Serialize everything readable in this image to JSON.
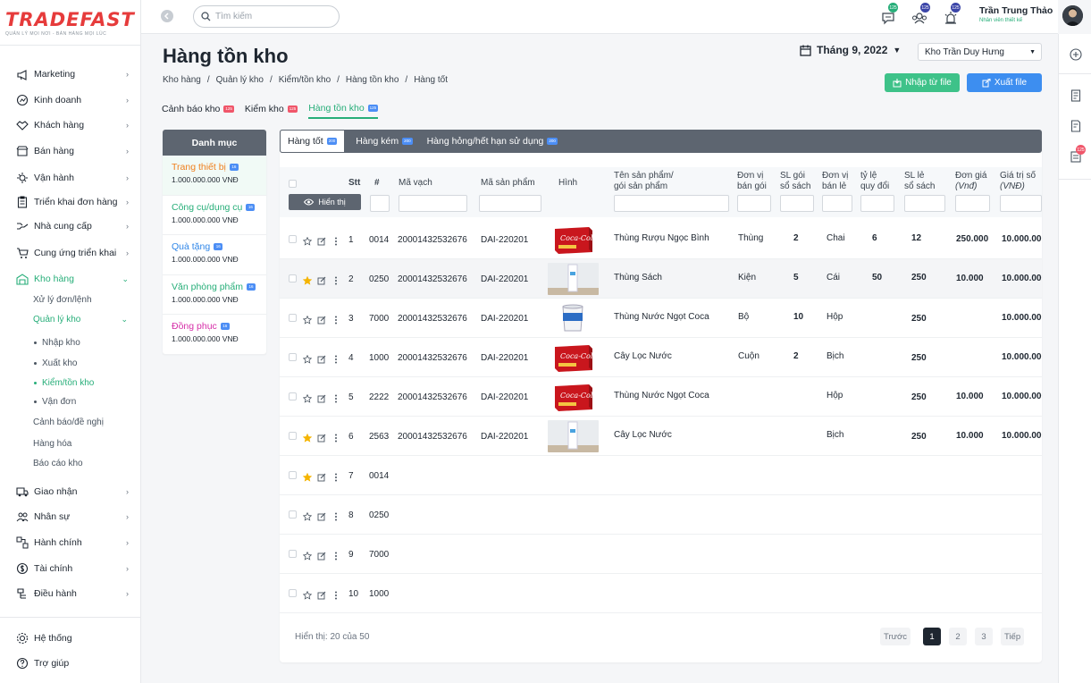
{
  "brand": {
    "logo_a": "TRADE",
    "logo_b": "FAST",
    "tagline": "QUẢN LÝ MỌI NƠI - BÁN HÀNG MỌI LÚC"
  },
  "sidebar": {
    "items": [
      {
        "label": "Marketing",
        "icon": "megaphone-icon"
      },
      {
        "label": "Kinh doanh",
        "icon": "business-icon"
      },
      {
        "label": "Khách hàng",
        "icon": "handshake-icon"
      },
      {
        "label": "Bán hàng",
        "icon": "shop-icon"
      },
      {
        "label": "Vận hành",
        "icon": "operations-icon"
      },
      {
        "label": "Triển khai đơn hàng",
        "icon": "clipboard-icon"
      },
      {
        "label": "Nhà cung cấp",
        "icon": "supplier-icon"
      },
      {
        "label": "Cung ứng triển khai",
        "icon": "cart-icon"
      },
      {
        "label": "Kho hàng",
        "icon": "warehouse-icon"
      }
    ],
    "warehouse_sub": [
      "Xử lý đơn/lệnh",
      "Quản lý kho"
    ],
    "inventory_sub": [
      "Nhập kho",
      "Xuất kho",
      "Kiểm/tồn kho",
      "Vận đơn"
    ],
    "warehouse_more": [
      "Cảnh báo/đề nghị",
      "Hàng hóa",
      "Báo cáo kho"
    ],
    "items2": [
      {
        "label": "Giao nhận",
        "icon": "delivery-icon"
      },
      {
        "label": "Nhân sự",
        "icon": "people-icon"
      },
      {
        "label": "Hành chính",
        "icon": "admin-icon"
      },
      {
        "label": "Tài chính",
        "icon": "finance-icon"
      },
      {
        "label": "Điều hành",
        "icon": "management-icon"
      }
    ],
    "bottom": [
      {
        "label": "Hệ thống",
        "icon": "gear-icon"
      },
      {
        "label": "Trợ giúp",
        "icon": "help-icon"
      }
    ]
  },
  "header": {
    "search_placeholder": "Tìm kiếm",
    "badges": [
      "125",
      "125",
      "125"
    ],
    "user_name": "Trần Trung Thảo",
    "user_role": "Nhân viên thiết kế",
    "rail_badge": "125"
  },
  "page": {
    "title": "Hàng tồn kho",
    "breadcrumb": [
      "Kho hàng",
      "Quản lý kho",
      "Kiểm/tồn kho",
      "Hàng tồn kho",
      "Hàng tốt"
    ],
    "month": "Tháng 9, 2022",
    "warehouse": "Kho Trần Duy Hưng",
    "import_label": "Nhập từ file",
    "export_label": "Xuất file"
  },
  "tabs": [
    {
      "label": "Cảnh báo kho",
      "badge": "125"
    },
    {
      "label": "Kiểm kho",
      "badge": "125"
    },
    {
      "label": "Hàng tồn kho",
      "badge": "125"
    }
  ],
  "categories": {
    "title": "Danh mục",
    "items": [
      {
        "name": "Trang thiết bị",
        "badge": "16",
        "value": "1.000.000.000 VNĐ",
        "color": "#f07f1d"
      },
      {
        "name": "Công cụ/dụng cụ",
        "badge": "16",
        "value": "1.000.000.000 VNĐ",
        "color": "#27ae79"
      },
      {
        "name": "Quà tặng",
        "badge": "16",
        "value": "1.000.000.000 VNĐ",
        "color": "#2f86e8"
      },
      {
        "name": "Văn phòng phẩm",
        "badge": "16",
        "value": "1.000.000.000 VNĐ",
        "color": "#27ae79"
      },
      {
        "name": "Đồng phục",
        "badge": "16",
        "value": "1.000.000.000 VNĐ",
        "color": "#d62fa8"
      }
    ]
  },
  "subtabs": [
    {
      "label": "Hàng tốt",
      "badge": "200"
    },
    {
      "label": "Hàng kém",
      "badge": "200"
    },
    {
      "label": "Hàng hỏng/hết hạn sử dụng",
      "badge": "200"
    }
  ],
  "table": {
    "show_label": "Hiển thị",
    "headers": {
      "stt": "Stt",
      "hash": "#",
      "barcode": "Mã vạch",
      "sku": "Mã sản phẩm",
      "image": "Hình",
      "name_1": "Tên sản phẩm/",
      "name_2": "gói sản phẩm",
      "pack_unit_1": "Đơn vị",
      "pack_unit_2": "bán gói",
      "pack_qty_1": "SL gói",
      "pack_qty_2": "sổ sách",
      "unit_1": "Đơn vị",
      "unit_2": "bán lẻ",
      "ratio_1": "tỷ lệ",
      "ratio_2": "quy đổi",
      "qty_1": "SL lẻ",
      "qty_2": "sổ sách",
      "price_1": "Đơn giá",
      "price_2": "(Vnđ)",
      "value_1": "Giá trị số",
      "value_2": "(VNĐ)"
    },
    "rows": [
      {
        "stt": "1",
        "code": "0014",
        "barcode": "20001432532676",
        "sku": "DAI-220201",
        "img": "coca",
        "name": "Thùng Rượu Ngọc Bình",
        "pack_unit": "Thùng",
        "pack_qty": "2",
        "unit": "Chai",
        "ratio": "6",
        "qty": "12",
        "price": "250.000",
        "value": "10.000.000",
        "star": false
      },
      {
        "stt": "2",
        "code": "0250",
        "barcode": "20001432532676",
        "sku": "DAI-220201",
        "img": "water",
        "name": "Thùng Sách",
        "pack_unit": "Kiện",
        "pack_qty": "5",
        "unit": "Cái",
        "ratio": "50",
        "qty": "250",
        "price": "10.000",
        "value": "10.000.000",
        "star": true
      },
      {
        "stt": "3",
        "code": "7000",
        "barcode": "20001432532676",
        "sku": "DAI-220201",
        "img": "paint",
        "name": "Thùng Nước Ngọt Coca",
        "pack_unit": "Bộ",
        "pack_qty": "10",
        "unit": "Hộp",
        "ratio": "",
        "qty": "250",
        "price": "",
        "value": "10.000.000",
        "star": false
      },
      {
        "stt": "4",
        "code": "1000",
        "barcode": "20001432532676",
        "sku": "DAI-220201",
        "img": "coca",
        "name": "Cây Lọc Nước",
        "pack_unit": "Cuộn",
        "pack_qty": "2",
        "unit": "Bịch",
        "ratio": "",
        "qty": "250",
        "price": "",
        "value": "10.000.000",
        "star": false
      },
      {
        "stt": "5",
        "code": "2222",
        "barcode": "20001432532676",
        "sku": "DAI-220201",
        "img": "coca",
        "name": "Thùng Nước Ngọt Coca",
        "pack_unit": "",
        "pack_qty": "",
        "unit": "Hộp",
        "ratio": "",
        "qty": "250",
        "price": "10.000",
        "value": "10.000.000",
        "star": false
      },
      {
        "stt": "6",
        "code": "2563",
        "barcode": "20001432532676",
        "sku": "DAI-220201",
        "img": "water",
        "name": "Cây Lọc Nước",
        "pack_unit": "",
        "pack_qty": "",
        "unit": "Bịch",
        "ratio": "",
        "qty": "250",
        "price": "10.000",
        "value": "10.000.000",
        "star": true
      },
      {
        "stt": "7",
        "code": "0014",
        "barcode": "",
        "sku": "",
        "img": "",
        "name": "",
        "pack_unit": "",
        "pack_qty": "",
        "unit": "",
        "ratio": "",
        "qty": "",
        "price": "",
        "value": "",
        "star": true
      },
      {
        "stt": "8",
        "code": "0250",
        "barcode": "",
        "sku": "",
        "img": "",
        "name": "",
        "pack_unit": "",
        "pack_qty": "",
        "unit": "",
        "ratio": "",
        "qty": "",
        "price": "",
        "value": "",
        "star": false
      },
      {
        "stt": "9",
        "code": "7000",
        "barcode": "",
        "sku": "",
        "img": "",
        "name": "",
        "pack_unit": "",
        "pack_qty": "",
        "unit": "",
        "ratio": "",
        "qty": "",
        "price": "",
        "value": "",
        "star": false
      },
      {
        "stt": "10",
        "code": "1000",
        "barcode": "",
        "sku": "",
        "img": "",
        "name": "",
        "pack_unit": "",
        "pack_qty": "",
        "unit": "",
        "ratio": "",
        "qty": "",
        "price": "",
        "value": "",
        "star": false
      }
    ],
    "footer_info": "Hiển thị: 20 của 50"
  },
  "pagination": {
    "prev": "Trước",
    "pages": [
      "1",
      "2",
      "3"
    ],
    "next": "Tiếp",
    "current": "1"
  },
  "colors": {
    "accent": "#27ae79",
    "dark": "#5d6570",
    "import": "#3ec289",
    "export": "#3d8ef0",
    "badge_red": "#f0566a",
    "badge_blue": "#4c8ef5"
  }
}
